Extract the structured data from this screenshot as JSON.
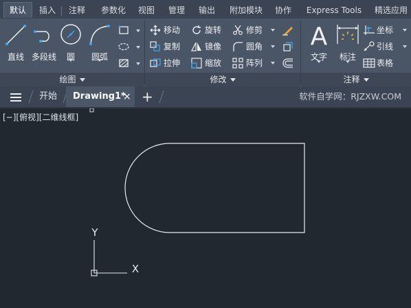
{
  "ribbon": {
    "tabs": [
      "默认",
      "插入",
      "注释",
      "参数化",
      "视图",
      "管理",
      "输出",
      "附加模块",
      "协作",
      "Express Tools",
      "精选应用"
    ],
    "active_tab": "默认"
  },
  "draw_group": {
    "title": "绘图",
    "line": "直线",
    "polyline": "多段线",
    "circle": "圆",
    "arc": "圆弧"
  },
  "modify_group": {
    "title": "修改",
    "move": "移动",
    "rotate": "旋转",
    "trim": "修剪",
    "copy": "复制",
    "mirror": "镜像",
    "fillet": "圆角",
    "stretch": "拉伸",
    "scale": "缩放",
    "array": "阵列"
  },
  "annotation_group": {
    "title": "注释",
    "text": "文字",
    "dimension": "标注",
    "coordinate": "坐标",
    "leader": "引线",
    "table": "表格"
  },
  "file_tabs": {
    "start": "开始",
    "drawing": "Drawing1*",
    "close_symbol": "×",
    "add_symbol": "+"
  },
  "brand": "软件自学网：RJZXW.COM",
  "viewport": {
    "label": "[−][俯视][二维线框]"
  },
  "ucs": {
    "x_label": "X",
    "y_label": "Y"
  },
  "colors": {
    "canvas_bg": "#212830",
    "ribbon_bg": "#4a5566",
    "tab_bar_bg": "#3b4453",
    "accent_blue": "#3fa9f5"
  }
}
